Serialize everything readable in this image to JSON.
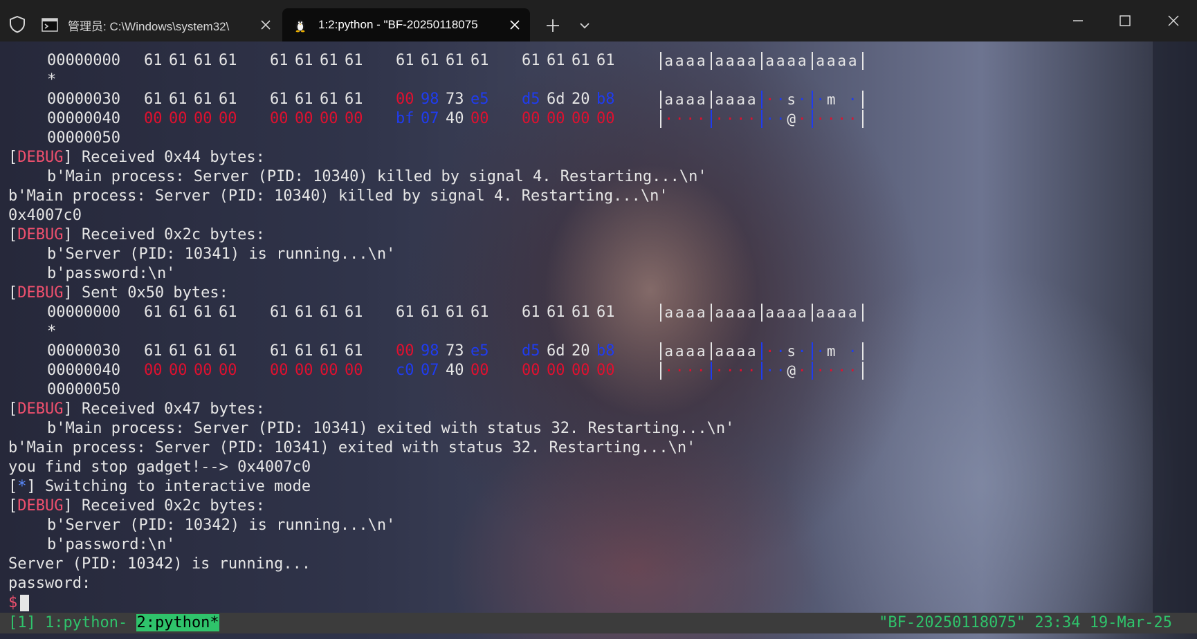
{
  "tabs": [
    {
      "label": "管理员: C:\\Windows\\system32\\",
      "icon": "cmd-icon",
      "active": false
    },
    {
      "label": "1:2:python - \"BF-20250118075",
      "icon": "linux-penguin-icon",
      "active": true
    }
  ],
  "theme": {
    "red": "#e0102f",
    "blue": "#1f3cf0",
    "debug": "#f0506e",
    "status_green": "#2fc36b"
  },
  "terminal": {
    "dump1": {
      "r0": {
        "off": "00000000",
        "b": [
          "61",
          "61",
          "61",
          "61",
          "61",
          "61",
          "61",
          "61",
          "61",
          "61",
          "61",
          "61",
          "61",
          "61",
          "61",
          "61"
        ],
        "a": [
          "aaaa",
          "aaaa",
          "aaaa",
          "aaaa"
        ]
      },
      "star": "*",
      "r1": {
        "off": "00000030",
        "b": [
          "61",
          "61",
          "61",
          "61",
          "61",
          "61",
          "61",
          "61",
          "00",
          "98",
          "73",
          "e5",
          "d5",
          "6d",
          "20",
          "b8"
        ],
        "a": [
          "aaaa",
          "aaaa",
          "··s·",
          "·m ·"
        ]
      },
      "r2": {
        "off": "00000040",
        "b": [
          "00",
          "00",
          "00",
          "00",
          "00",
          "00",
          "00",
          "00",
          "bf",
          "07",
          "40",
          "00",
          "00",
          "00",
          "00",
          "00"
        ],
        "a": [
          "····",
          "····",
          "··@·",
          "····"
        ]
      },
      "end": "00000050"
    },
    "l_recv44_tag": "DEBUG",
    "l_recv44": "] Received 0x44 bytes:",
    "l_main1a": "b'Main process: Server (PID: 10340) killed by signal 4. Restarting...\\n'",
    "l_main1b": "b'Main process: Server (PID: 10340) killed by signal 4. Restarting...\\n'",
    "l_addr": "0x4007c0",
    "l_recv2c_tag": "DEBUG",
    "l_recv2c": "] Received 0x2c bytes:",
    "l_srv1": "b'Server (PID: 10341) is running...\\n'",
    "l_pw1": "b'password:\\n'",
    "l_sent_tag": "DEBUG",
    "l_sent": "] Sent 0x50 bytes:",
    "dump2": {
      "r0": {
        "off": "00000000",
        "b": [
          "61",
          "61",
          "61",
          "61",
          "61",
          "61",
          "61",
          "61",
          "61",
          "61",
          "61",
          "61",
          "61",
          "61",
          "61",
          "61"
        ],
        "a": [
          "aaaa",
          "aaaa",
          "aaaa",
          "aaaa"
        ]
      },
      "star": "*",
      "r1": {
        "off": "00000030",
        "b": [
          "61",
          "61",
          "61",
          "61",
          "61",
          "61",
          "61",
          "61",
          "00",
          "98",
          "73",
          "e5",
          "d5",
          "6d",
          "20",
          "b8"
        ],
        "a": [
          "aaaa",
          "aaaa",
          "··s·",
          "·m ·"
        ]
      },
      "r2": {
        "off": "00000040",
        "b": [
          "00",
          "00",
          "00",
          "00",
          "00",
          "00",
          "00",
          "00",
          "c0",
          "07",
          "40",
          "00",
          "00",
          "00",
          "00",
          "00"
        ],
        "a": [
          "····",
          "····",
          "··@·",
          "····"
        ]
      },
      "end": "00000050"
    },
    "l_recv47_tag": "DEBUG",
    "l_recv47": "] Received 0x47 bytes:",
    "l_main2a": "b'Main process: Server (PID: 10341) exited with status 32. Restarting...\\n'",
    "l_main2b": "b'Main process: Server (PID: 10341) exited with status 32. Restarting...\\n'",
    "l_found": "you find stop gadget!--> 0x4007c0",
    "l_switch_tag": "*",
    "l_switch": "] Switching to interactive mode",
    "l_recv2c2_tag": "DEBUG",
    "l_recv2c2": "] Received 0x2c bytes:",
    "l_srv2": "b'Server (PID: 10342) is running...\\n'",
    "l_pw2": "b'password:\\n'",
    "l_srv3": "Server (PID: 10342) is running...",
    "l_pw3": "password:",
    "prompt": "$"
  },
  "statusbar": {
    "session": "[1]",
    "win1": "1:python-",
    "win2": "2:python*",
    "right": "\"BF-20250118075\" 23:34 19-Mar-25"
  }
}
